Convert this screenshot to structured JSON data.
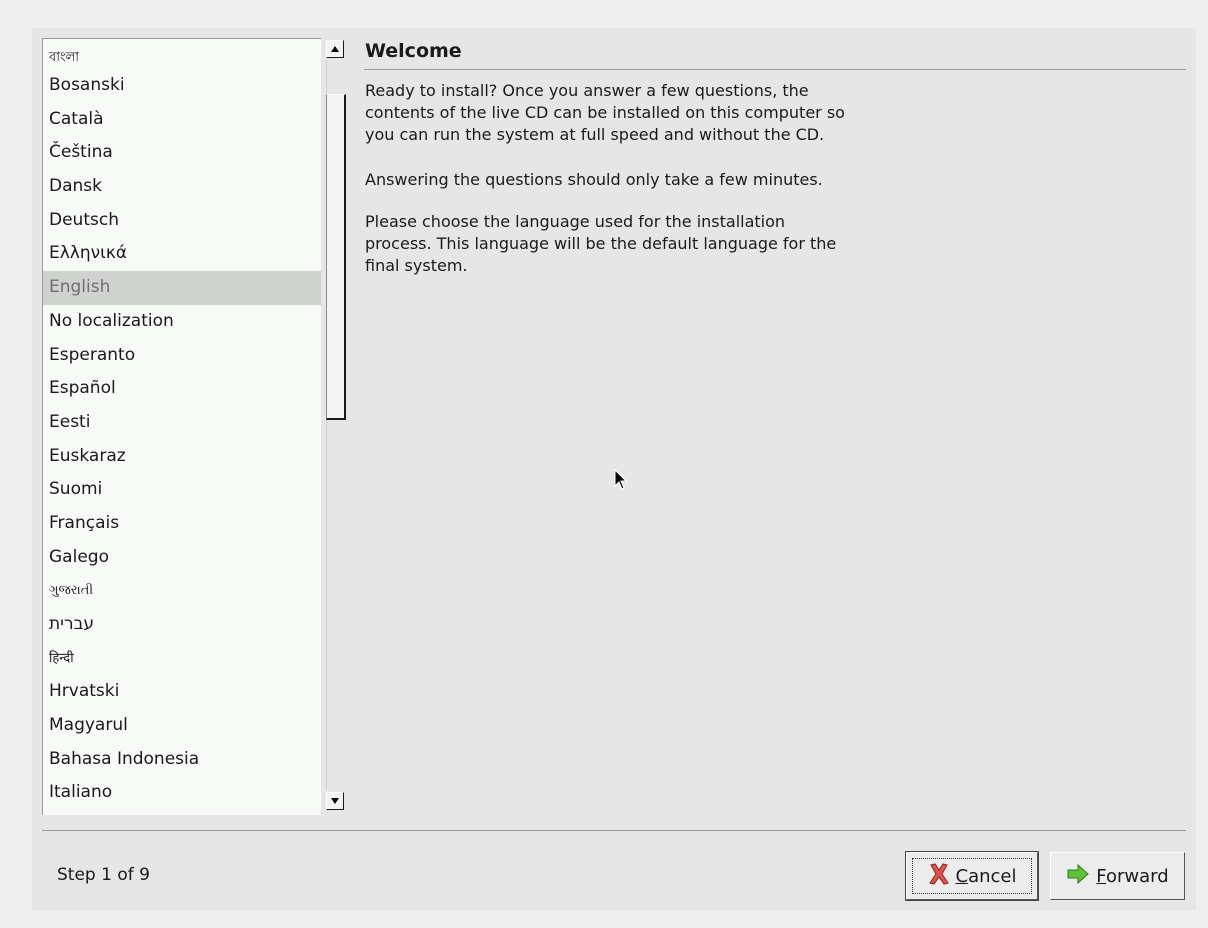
{
  "languages": [
    {
      "label": "বাংলা",
      "small": true
    },
    {
      "label": "Bosanski"
    },
    {
      "label": "Català"
    },
    {
      "label": "Čeština"
    },
    {
      "label": "Dansk"
    },
    {
      "label": "Deutsch"
    },
    {
      "label": "Ελληνικά"
    },
    {
      "label": "English",
      "selected": true
    },
    {
      "label": "No localization"
    },
    {
      "label": "Esperanto"
    },
    {
      "label": "Español"
    },
    {
      "label": "Eesti"
    },
    {
      "label": "Euskaraz"
    },
    {
      "label": "Suomi"
    },
    {
      "label": "Français"
    },
    {
      "label": "Galego"
    },
    {
      "label": "ગુજરાતી",
      "small": true
    },
    {
      "label": "עברית"
    },
    {
      "label": "हिन्दी",
      "small": true
    },
    {
      "label": "Hrvatski"
    },
    {
      "label": "Magyarul"
    },
    {
      "label": "Bahasa Indonesia"
    },
    {
      "label": "Italiano"
    }
  ],
  "content": {
    "title": "Welcome",
    "para1": "Ready to install? Once you answer a few questions, the\ncontents of the live CD can be installed on this computer so\nyou can run the system at full speed and without the CD.",
    "para2": "Answering the questions should only take a few minutes.",
    "para3": "Please choose the language used for the installation\nprocess. This language will be the default language for the\nfinal system."
  },
  "footer": {
    "step": "Step 1 of 9",
    "cancel_mnemonic": "C",
    "cancel_rest": "ancel",
    "forward_mnemonic": "F",
    "forward_rest": "orward"
  },
  "icons": {
    "cancel": "cancel-x-icon",
    "forward": "forward-arrow-icon"
  },
  "colors": {
    "selection": "#cfd2cf",
    "list_bg": "#f7faf7",
    "window_bg": "#e6e6e6",
    "cancel_icon": "#e8504a",
    "forward_icon": "#5cc236"
  }
}
